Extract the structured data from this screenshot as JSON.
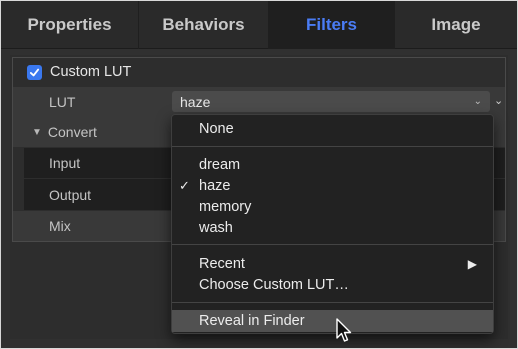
{
  "tabs": [
    {
      "label": "Properties",
      "active": false
    },
    {
      "label": "Behaviors",
      "active": false
    },
    {
      "label": "Filters",
      "active": true
    },
    {
      "label": "Image",
      "active": false
    }
  ],
  "filter": {
    "name": "Custom LUT",
    "checked": true,
    "rows": {
      "lut_label": "LUT",
      "lut_value": "haze",
      "convert_label": "Convert",
      "input_label": "Input",
      "output_label": "Output",
      "mix_label": "Mix"
    }
  },
  "menu": {
    "none": "None",
    "items": [
      "dream",
      "haze",
      "memory",
      "wash"
    ],
    "checked_item": "haze",
    "recent": "Recent",
    "choose": "Choose Custom LUT…",
    "reveal": "Reveal in Finder"
  },
  "icons": {
    "checkbox": "checkmark-icon",
    "disclosure": "triangle-down-icon",
    "popup": "chevron-down-icon",
    "submenu": "triangle-right-icon",
    "cursor": "pointer-cursor-icon"
  },
  "colors": {
    "accent": "#4a7cf5",
    "checkbox": "#3a78ef",
    "menu_bg": "#222222",
    "highlight": "#515151"
  }
}
